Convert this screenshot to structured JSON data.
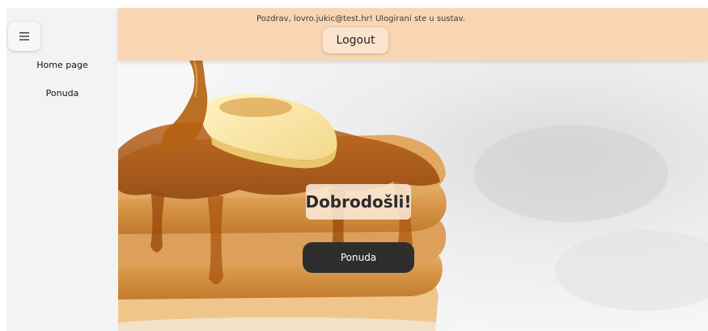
{
  "sidebar": {
    "menu_icon": "hamburger-icon",
    "items": [
      {
        "label": "Home page"
      },
      {
        "label": "Ponuda"
      }
    ]
  },
  "header": {
    "greeting": "Pozdrav, lovro.jukic@test.hr! Ulogirani ste u sustav.",
    "logout_label": "Logout"
  },
  "hero": {
    "welcome_text": "Dobrodošli!",
    "cta_label": "Ponuda"
  },
  "colors": {
    "header_bg": "#f8d6b4",
    "sidebar_bg": "#f3f3f3",
    "cta_bg": "#2e2e2e",
    "syrup": "#c8741f"
  }
}
